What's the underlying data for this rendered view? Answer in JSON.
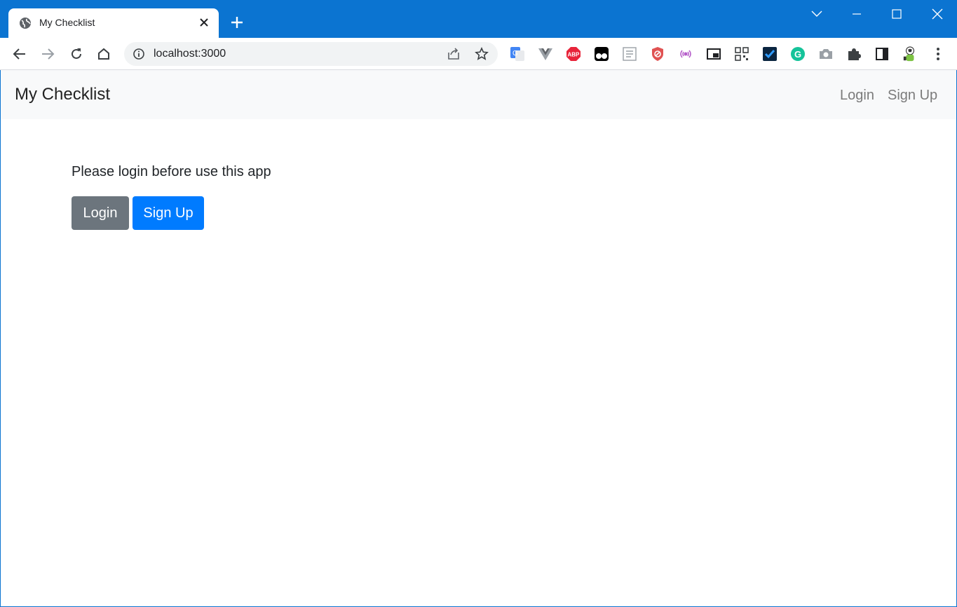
{
  "browser": {
    "tab_title": "My Checklist",
    "url": "localhost:3000",
    "extensions": [
      "google-translate-icon",
      "vue-icon",
      "adblock-plus-icon",
      "tampermonkey-icon",
      "reader-icon",
      "shield-icon",
      "broadcast-icon",
      "picture-in-picture-icon",
      "qr-code-icon",
      "todo-check-icon",
      "grammarly-icon",
      "camera-icon",
      "puzzle-icon",
      "side-panel-icon",
      "avatar-icon",
      "menu-icon"
    ],
    "abp_label": "ABP",
    "grammarly_label": "G"
  },
  "navbar": {
    "brand": "My Checklist",
    "login": "Login",
    "signup": "Sign Up"
  },
  "main": {
    "message": "Please login before use this app",
    "login_button": "Login",
    "signup_button": "Sign Up"
  },
  "colors": {
    "titlebar": "#0b74d1",
    "btn_secondary": "#6c757d",
    "btn_primary": "#007bff"
  }
}
